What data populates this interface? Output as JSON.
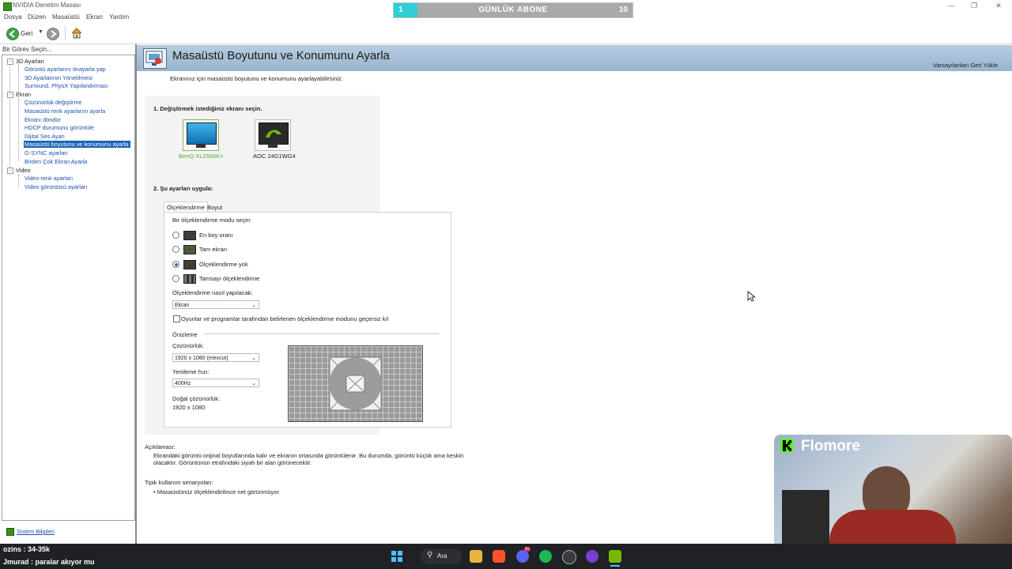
{
  "window": {
    "title": "NVIDIA Denetim Masası"
  },
  "subscriber_goal": {
    "current": "1",
    "label": "GÜNLÜK ABONE",
    "target": "10",
    "progress_fraction": 0.1,
    "fill_color": "#2ecfd8"
  },
  "menu": {
    "items": [
      "Dosya",
      "Düzen",
      "Masaüstü",
      "Ekran",
      "Yardım"
    ]
  },
  "toolbar": {
    "back_label": "Geri"
  },
  "left_panel": {
    "header": "Bir Görev Seçin...",
    "tree": [
      {
        "label": "3D Ayarları",
        "type": "category"
      },
      {
        "label": "Görüntü ayarlarını önayarla yap",
        "type": "link"
      },
      {
        "label": "3D Ayarlarının Yönetilmesi",
        "type": "link"
      },
      {
        "label": "Surround, PhysX Yapılandırması",
        "type": "link"
      },
      {
        "label": "Ekran",
        "type": "category"
      },
      {
        "label": "Çözünürlük değiştirme",
        "type": "link"
      },
      {
        "label": "Masaüstü renk ayarlarını ayarla",
        "type": "link"
      },
      {
        "label": "Ekranı döndür",
        "type": "link"
      },
      {
        "label": "HDCP durumunu görüntüle",
        "type": "link"
      },
      {
        "label": "Dijital Ses Ayarı",
        "type": "link"
      },
      {
        "label": "Masaüstü boyutunu ve konumunu ayarla",
        "type": "link",
        "selected": true
      },
      {
        "label": "G-SYNC ayarları",
        "type": "link"
      },
      {
        "label": "Birden Çok Ekran Ayarla",
        "type": "link"
      },
      {
        "label": "Video",
        "type": "category"
      },
      {
        "label": "Video renk ayarları",
        "type": "link"
      },
      {
        "label": "Video görüntüsü ayarları",
        "type": "link"
      }
    ],
    "system_info_link": "Sistem Bilgileri"
  },
  "page": {
    "title": "Masaüstü Boyutunu ve Konumunu Ayarla",
    "restore_defaults": "Varsayılanları Geri Yükle",
    "intro": "Ekranınız için masaüstü boyutunu ve konumunu ayarlayabilirsiniz.",
    "step1": "1. Değiştirmek istediğiniz ekranı seçin.",
    "displays": [
      {
        "name": "BenQ XL2566K+",
        "selected": true
      },
      {
        "name": "AOC 24G1WG4",
        "selected": false
      }
    ],
    "step2": "2. Şu ayarları uygula:",
    "tabs": [
      "Ölçeklendirme",
      "Boyut"
    ],
    "scaling_mode_label": "Bir ölçeklendirme modu seçin:",
    "scaling_modes": [
      {
        "label": "En boy oranı",
        "selected": false
      },
      {
        "label": "Tam ekran",
        "selected": false
      },
      {
        "label": "Ölçeklendirme yok",
        "selected": true
      },
      {
        "label": "Tamsayı ölçeklendirme",
        "selected": false
      }
    ],
    "perform_on_label": "Ölçeklendirme nasıl yapılacak:",
    "perform_on_value": "Ekran",
    "override_checkbox": "Oyunlar ve programlar tarafından belirlenen ölçeklendirme modunu geçersiz kıl",
    "override_checked": false,
    "preview_label": "Önizleme",
    "resolution_label": "Çözünürlük:",
    "resolution_value": "1920 x 1080 (mevcut)",
    "refresh_label": "Yenileme hızı:",
    "refresh_value": "400Hz",
    "native_label": "Doğal çözünürlük:",
    "native_value": "1920 x 1080",
    "description_label": "Açıklaması:",
    "description_line1": "Ekrandaki görüntü orijinal boyutlarında kalır ve ekranın ortasında görüntülenir. Bu durumda, görüntü küçük ama keskin",
    "description_line2": "olacaktır. Görüntünün etrafındaki siyah bir alan görünecektir.",
    "usage_label": "Tipik kullanım senaryoları:",
    "usage_item": "• Masaüstünüz ölçeklendirilince net görünmüyor"
  },
  "taskbar": {
    "search_label": "Ara",
    "discord_badge": "9+"
  },
  "overlay": {
    "streamer_name": "Flomore",
    "chat_line1": "ozins : 34-35k",
    "chat_line2": "Jmurad : paralar akıyor mu"
  }
}
